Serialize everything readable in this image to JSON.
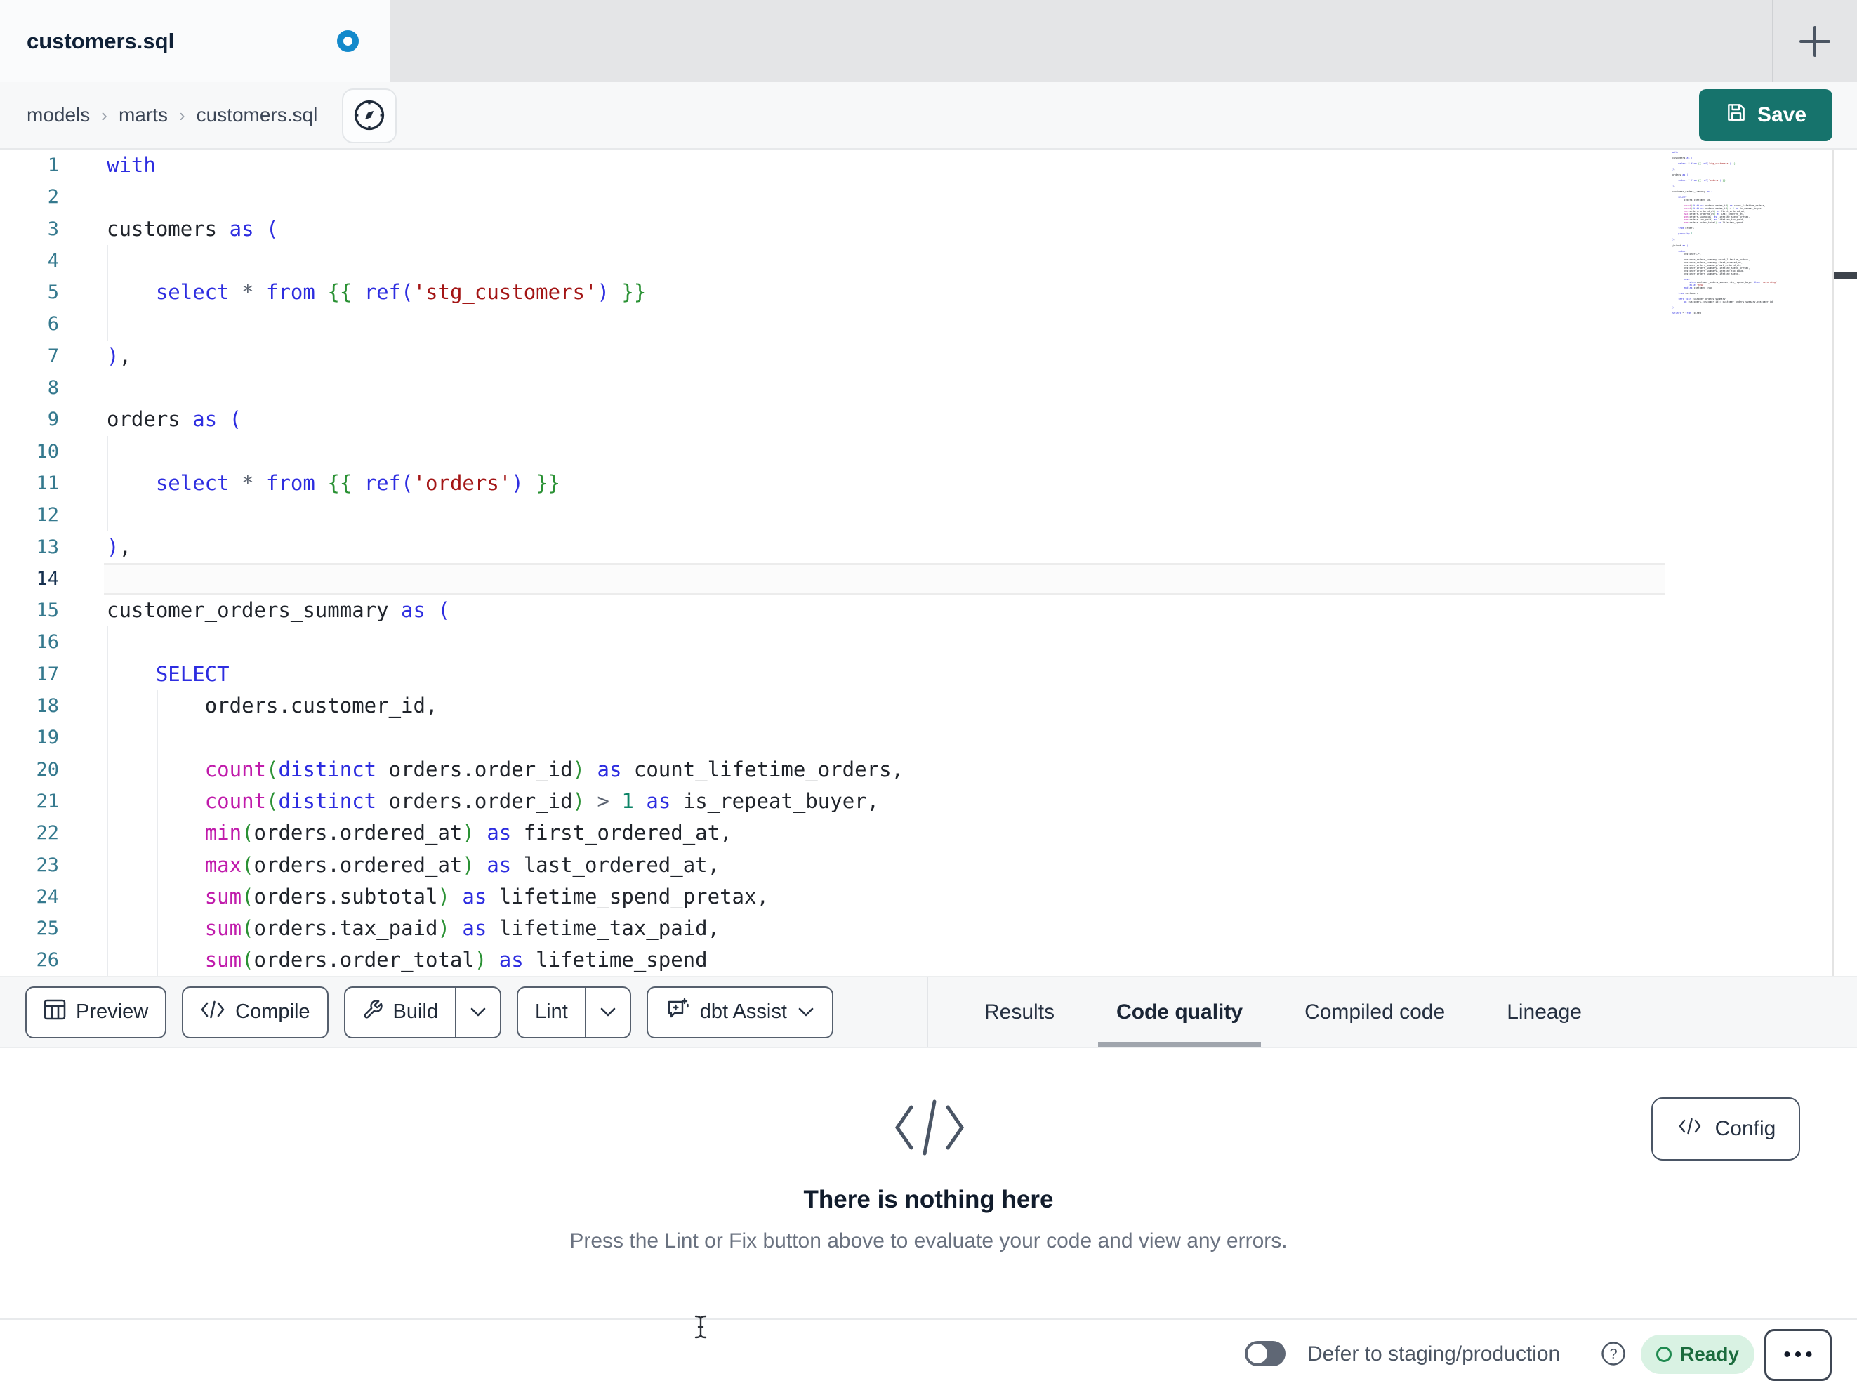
{
  "tab_bar": {
    "active_tab": "customers.sql"
  },
  "breadcrumb": {
    "items": [
      "models",
      "marts",
      "customers.sql"
    ],
    "separator": "›"
  },
  "save_button": {
    "label": "Save"
  },
  "editor": {
    "active_line": 14,
    "visible_lines": [
      {
        "text": "with",
        "guides": []
      },
      {
        "text": "",
        "guides": []
      },
      {
        "text": "customers as (",
        "guides": []
      },
      {
        "text": "",
        "guides": [
          0
        ]
      },
      {
        "text": "    select * from {{ ref('stg_customers') }}",
        "guides": [
          0
        ]
      },
      {
        "text": "",
        "guides": [
          0
        ]
      },
      {
        "text": "),",
        "guides": []
      },
      {
        "text": "",
        "guides": []
      },
      {
        "text": "orders as (",
        "guides": []
      },
      {
        "text": "",
        "guides": [
          0
        ]
      },
      {
        "text": "    select * from {{ ref('orders') }}",
        "guides": [
          0
        ]
      },
      {
        "text": "",
        "guides": [
          0
        ]
      },
      {
        "text": "),",
        "guides": []
      },
      {
        "text": "",
        "guides": []
      },
      {
        "text": "customer_orders_summary as (",
        "guides": []
      },
      {
        "text": "",
        "guides": [
          0
        ]
      },
      {
        "text": "    SELECT",
        "guides": [
          0
        ]
      },
      {
        "text": "        orders.customer_id,",
        "guides": [
          0,
          1
        ]
      },
      {
        "text": "",
        "guides": [
          0,
          1
        ]
      },
      {
        "text": "        count(distinct orders.order_id) as count_lifetime_orders,",
        "guides": [
          0,
          1
        ]
      },
      {
        "text": "        count(distinct orders.order_id) > 1 as is_repeat_buyer,",
        "guides": [
          0,
          1
        ]
      },
      {
        "text": "        min(orders.ordered_at) as first_ordered_at,",
        "guides": [
          0,
          1
        ]
      },
      {
        "text": "        max(orders.ordered_at) as last_ordered_at,",
        "guides": [
          0,
          1
        ]
      },
      {
        "text": "        sum(orders.subtotal) as lifetime_spend_pretax,",
        "guides": [
          0,
          1
        ]
      },
      {
        "text": "        sum(orders.tax_paid) as lifetime_tax_paid,",
        "guides": [
          0,
          1
        ]
      },
      {
        "text": "        sum(orders.order_total) as lifetime_spend",
        "guides": [
          0,
          1
        ]
      }
    ],
    "minimap_lines": [
      "with",
      "",
      "customers as (",
      "",
      "    select * from {{ ref('stg_customers') }}",
      "",
      "),",
      "",
      "orders as (",
      "",
      "    select * from {{ ref('orders') }}",
      "",
      "),",
      "",
      "customer_orders_summary as (",
      "",
      "    SELECT",
      "        orders.customer_id,",
      "",
      "        count(distinct orders.order_id) as count_lifetime_orders,",
      "        count(distinct orders.order_id) > 1 as is_repeat_buyer,",
      "        min(orders.ordered_at) as first_ordered_at,",
      "        max(orders.ordered_at) as last_ordered_at,",
      "        sum(orders.subtotal) as lifetime_spend_pretax,",
      "        sum(orders.tax_paid) as lifetime_tax_paid,",
      "        sum(orders.order_total) as lifetime_spend",
      "",
      "    from orders",
      "",
      "    group by 1",
      "",
      "),",
      "",
      "joined as (",
      "",
      "    select",
      "        customers.*,",
      "",
      "        customer_orders_summary.count_lifetime_orders,",
      "        customer_orders_summary.first_ordered_at,",
      "        customer_orders_summary.last_ordered_at,",
      "        customer_orders_summary.lifetime_spend_pretax,",
      "        customer_orders_summary.lifetime_tax_paid,",
      "        customer_orders_summary.lifetime_spend,",
      "",
      "        case",
      "            when customer_orders_summary.is_repeat_buyer then 'returning'",
      "            else 'new'",
      "        end as customer_type",
      "",
      "    from customers",
      "",
      "    left join customer_orders_summary",
      "        on customers.customer_id = customer_orders_summary.customer_id",
      "",
      ")",
      "",
      "select * from joined"
    ]
  },
  "toolbar": {
    "buttons": [
      {
        "name": "preview",
        "label": "Preview",
        "icon": "table-icon",
        "split": false,
        "chevron": false
      },
      {
        "name": "compile",
        "label": "Compile",
        "icon": "code-icon",
        "split": false,
        "chevron": false
      },
      {
        "name": "build",
        "label": "Build",
        "icon": "wrench-icon",
        "split": true,
        "chevron": true
      },
      {
        "name": "lint",
        "label": "Lint",
        "icon": null,
        "split": true,
        "chevron": true
      },
      {
        "name": "dbt-assist",
        "label": "dbt Assist",
        "icon": "chat-plus-icon",
        "split": false,
        "chevron": true
      }
    ],
    "tabs": [
      {
        "label": "Results",
        "active": false
      },
      {
        "label": "Code quality",
        "active": true
      },
      {
        "label": "Compiled code",
        "active": false
      },
      {
        "label": "Lineage",
        "active": false
      }
    ]
  },
  "panel": {
    "config_label": "Config",
    "empty_title": "There is nothing here",
    "empty_subtitle": "Press the Lint or Fix button above to evaluate your code and view any errors."
  },
  "status_bar": {
    "defer_label": "Defer to staging/production",
    "ready_label": "Ready",
    "toggle_state": "off"
  },
  "icons": {
    "new_tab": "plus-icon",
    "modified": "dot-icon",
    "breadcrumb_action": "compass-icon",
    "save": "floppy-icon",
    "config": "code-icon",
    "empty_state": "code-icon",
    "help": "question-circle-icon",
    "status_menu": "ellipsis-icon",
    "mouse_cursor": "text-ibeam-icon"
  },
  "colors": {
    "save_button": "#16736C",
    "modified_dot": "#1389CB",
    "ready_bg": "#D9F2E3",
    "ready_text": "#1A6B3C",
    "ready_ring": "#1F8A50",
    "keyword": "#2D2DE0",
    "function": "#C01BAB",
    "string": "#A31515",
    "jinja": "#2A9134",
    "number": "#0D8467",
    "line_number": "#35798E",
    "active_line_number": "#16304F",
    "active_tab_underline": "#A0A5AD"
  }
}
